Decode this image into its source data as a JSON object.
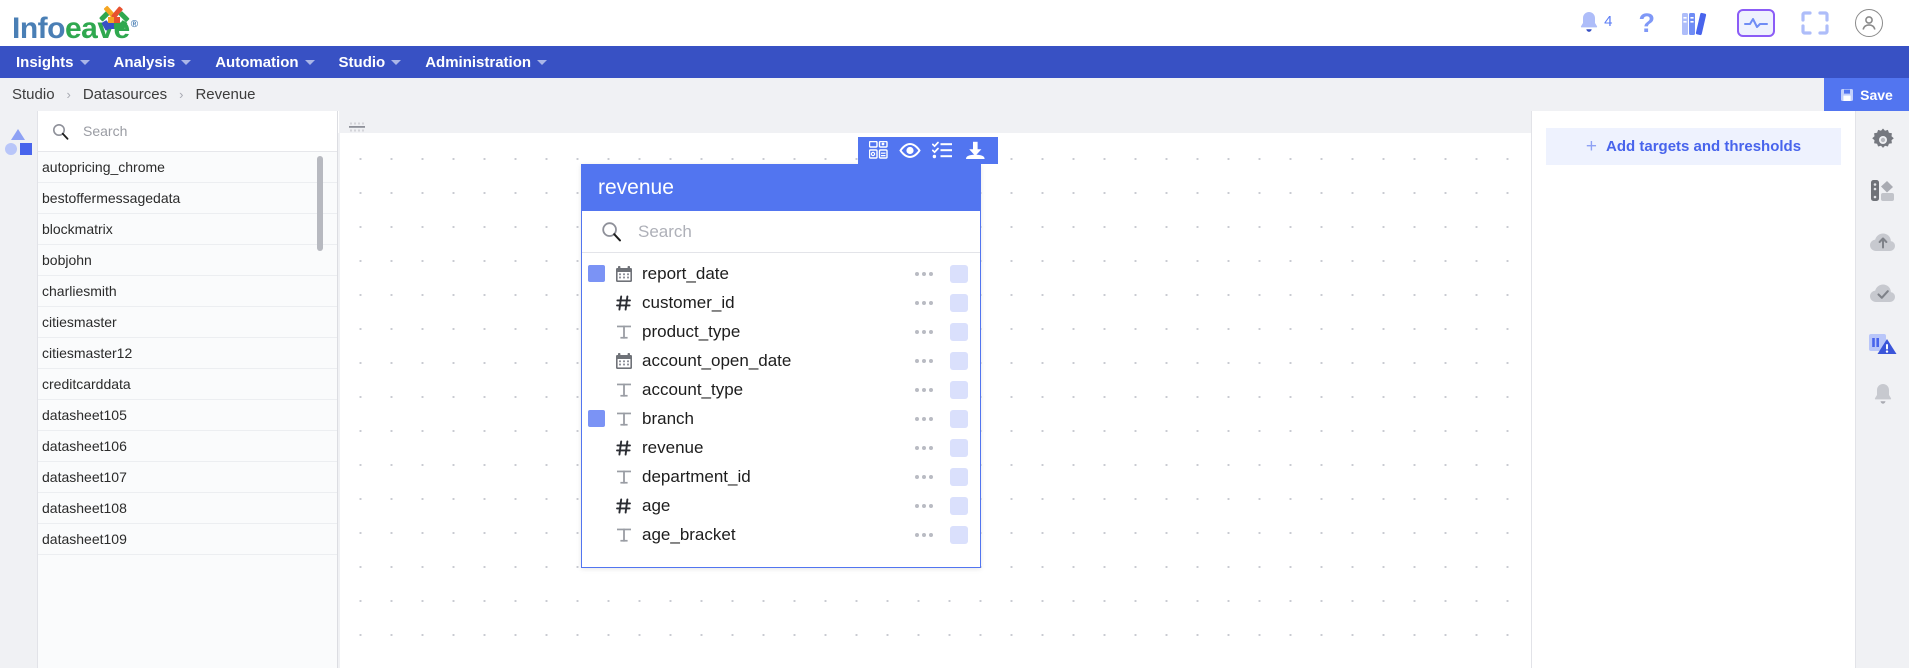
{
  "app": {
    "logo_first": "Info",
    "logo_second": "eave",
    "logo_registered": "®"
  },
  "topbar": {
    "notification_count": "4",
    "icons": [
      "bell-icon",
      "help-icon",
      "library-icon",
      "monitor-pulse-icon",
      "fullscreen-icon",
      "account-icon"
    ]
  },
  "nav": {
    "items": [
      {
        "label": "Insights"
      },
      {
        "label": "Analysis"
      },
      {
        "label": "Automation"
      },
      {
        "label": "Studio"
      },
      {
        "label": "Administration"
      }
    ]
  },
  "breadcrumb": {
    "items": [
      "Studio",
      "Datasources",
      "Revenue"
    ],
    "separator": "›"
  },
  "actions": {
    "save_label": "Save"
  },
  "datasource_panel": {
    "search_placeholder": "Search",
    "search_value": "",
    "items": [
      "autopricing_chrome",
      "bestoffermessagedata",
      "blockmatrix",
      "bobjohn",
      "charliesmith",
      "citiesmaster",
      "citiesmaster12",
      "creditcarddata",
      "datasheet105",
      "datasheet106",
      "datasheet107",
      "datasheet108",
      "datasheet109"
    ]
  },
  "widget": {
    "title": "revenue",
    "search_placeholder": "Search",
    "search_value": "",
    "toolbar_icons": [
      "layout-grid-icon",
      "eye-icon",
      "checklist-icon",
      "download-icon"
    ],
    "fields": [
      {
        "name": "report_date",
        "type": "date",
        "type_glyph": "calendar-icon",
        "selected": true
      },
      {
        "name": "customer_id",
        "type": "number",
        "type_glyph": "hash-icon",
        "selected": false
      },
      {
        "name": "product_type",
        "type": "text",
        "type_glyph": "text-icon",
        "selected": false
      },
      {
        "name": "account_open_date",
        "type": "date",
        "type_glyph": "calendar-icon",
        "selected": false
      },
      {
        "name": "account_type",
        "type": "text",
        "type_glyph": "text-icon",
        "selected": false
      },
      {
        "name": "branch",
        "type": "text",
        "type_glyph": "text-icon",
        "selected": true
      },
      {
        "name": "revenue",
        "type": "number",
        "type_glyph": "hash-icon",
        "selected": false
      },
      {
        "name": "department_id",
        "type": "text",
        "type_glyph": "text-icon",
        "selected": false
      },
      {
        "name": "age",
        "type": "number",
        "type_glyph": "hash-icon",
        "selected": false
      },
      {
        "name": "age_bracket",
        "type": "text",
        "type_glyph": "text-icon",
        "selected": false
      }
    ]
  },
  "right_panel": {
    "add_targets_label": "Add targets and thresholds",
    "add_targets_plus": "+",
    "rail_icons": [
      "settings-gear-icon",
      "color-palette-icon",
      "cloud-upload-icon",
      "cloud-check-icon",
      "chart-alert-icon",
      "bell-icon"
    ]
  },
  "colors": {
    "nav_blue": "#3851c4",
    "accent_blue": "#5275f0",
    "panel_bg": "#f0f1f4",
    "alert_blue": "#3b55d9"
  }
}
